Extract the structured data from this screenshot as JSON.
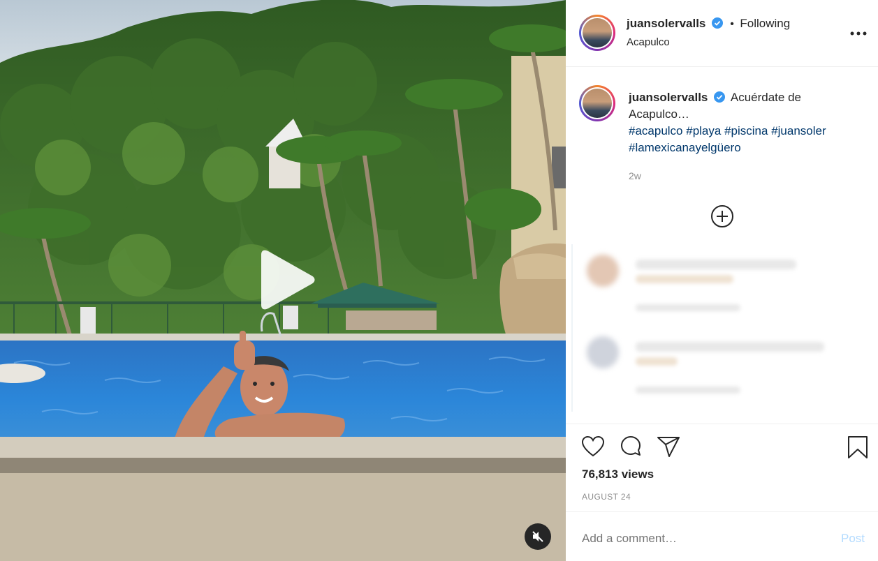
{
  "post": {
    "username": "juansolervalls",
    "separator": "•",
    "follow_status": "Following",
    "location": "Acapulco",
    "caption_text": "Acuérdate de Acapulco…",
    "hashtags": [
      "#acapulco",
      "#playa",
      "#piscina",
      "#juansoler",
      "#lamexicanayelgüero"
    ],
    "caption_age": "2w",
    "views": "76,813 views",
    "date": "AUGUST 24",
    "comment_placeholder": "Add a comment…",
    "post_button": "Post"
  },
  "icons": {
    "more": "more-options-icon",
    "verified": "verified-badge-icon",
    "load_more": "plus-circle-icon",
    "like": "heart-icon",
    "comment": "comment-icon",
    "share": "paper-plane-icon",
    "save": "bookmark-icon",
    "play": "play-icon",
    "mute": "muted-speaker-icon"
  },
  "colors": {
    "verified_blue": "#3897f0",
    "hashtag_blue": "#00376b",
    "post_button_disabled": "#b3dbff",
    "pool_blue": "#2a7fd0"
  }
}
